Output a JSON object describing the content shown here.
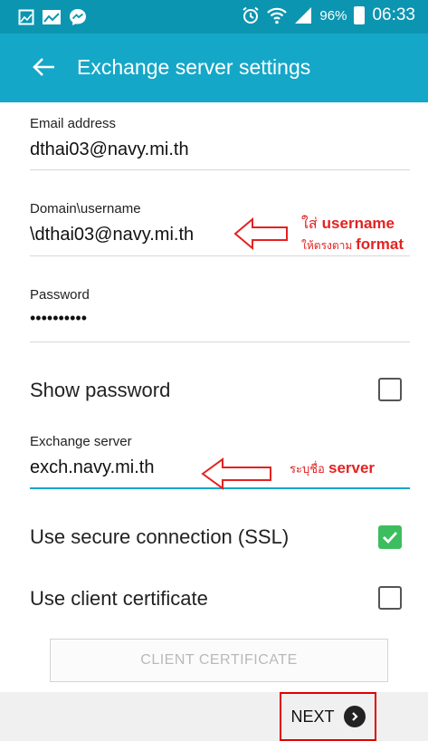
{
  "status_bar": {
    "battery": "96%",
    "time": "06:33",
    "icons": [
      "gallery-icon",
      "image-notification-icon",
      "messenger-icon",
      "alarm-icon",
      "wifi-icon",
      "signal-icon",
      "battery-icon"
    ]
  },
  "app_bar": {
    "title": "Exchange server settings",
    "back_icon": "arrow-left-icon"
  },
  "fields": {
    "email": {
      "label": "Email address",
      "value": "dthai03@navy.mi.th"
    },
    "domain_username": {
      "label": "Domain\\username",
      "value": "\\dthai03@navy.mi.th"
    },
    "password": {
      "label": "Password",
      "value": "••••••••••"
    },
    "exchange_server": {
      "label": "Exchange server",
      "value": "exch.navy.mi.th"
    }
  },
  "options": {
    "show_password": {
      "label": "Show password",
      "checked": false
    },
    "ssl": {
      "label": "Use secure connection (SSL)",
      "checked": true
    },
    "client_cert": {
      "label": "Use client certificate",
      "checked": false
    }
  },
  "client_certificate_button": "CLIENT CERTIFICATE",
  "next_button": {
    "label": "NEXT",
    "icon": "chevron-right-circle-icon"
  },
  "annotations": {
    "username": {
      "line1_th": "ใส่",
      "line1_en": "username",
      "line2_th": "ให้ตรงตาม",
      "line2_en": "format"
    },
    "server": {
      "line1_th": "ระบุชื่อ",
      "line1_en": "server"
    }
  },
  "colors": {
    "status_bar": "#0c95b1",
    "app_bar": "#15a7c8",
    "accent_underline": "#15a7c8",
    "checkbox_checked": "#3dbd5f",
    "annotation": "#e32222"
  }
}
